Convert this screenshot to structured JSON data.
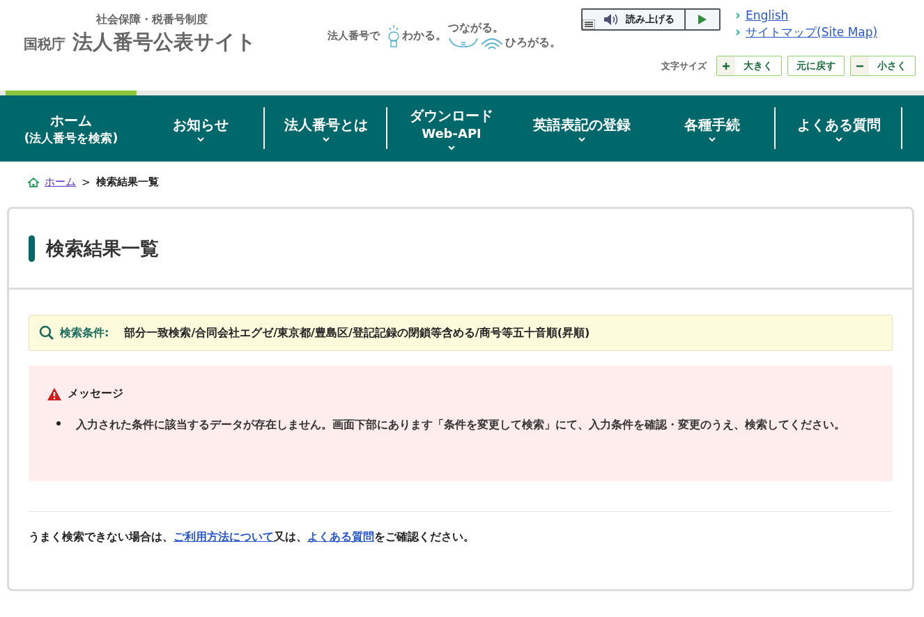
{
  "header": {
    "logo": {
      "subtitle": "社会保障・税番号制度",
      "agency": "国税庁",
      "title": "法人番号公表サイト"
    },
    "slogan": {
      "lead": "法人番号で",
      "words": [
        "わかる。",
        "つながる。",
        "ひろがる。"
      ]
    },
    "read_aloud": {
      "label": "読み上げる"
    },
    "links": [
      "English",
      "サイトマップ(Site Map)"
    ],
    "font_size": {
      "label": "文字サイズ",
      "buttons": [
        {
          "kind": "plus",
          "label": "大きく"
        },
        {
          "kind": "reset",
          "label": "元に戻す"
        },
        {
          "kind": "minus",
          "label": "小さく"
        }
      ]
    }
  },
  "nav": [
    {
      "lines": [
        "ホーム",
        "(法人番号を検索)"
      ],
      "selected": true,
      "has_menu": false,
      "divider": false
    },
    {
      "lines": [
        "お知らせ"
      ],
      "selected": false,
      "has_menu": true,
      "divider": true
    },
    {
      "lines": [
        "法人番号とは"
      ],
      "selected": false,
      "has_menu": true,
      "divider": true
    },
    {
      "lines": [
        "ダウンロード",
        "Web-API"
      ],
      "selected": false,
      "has_menu": true,
      "divider": false
    },
    {
      "lines": [
        "英語表記の登録"
      ],
      "selected": false,
      "has_menu": true,
      "divider": false
    },
    {
      "lines": [
        "各種手続"
      ],
      "selected": false,
      "has_menu": true,
      "divider": true
    },
    {
      "lines": [
        "よくある質問"
      ],
      "selected": false,
      "has_menu": true,
      "divider": true
    }
  ],
  "breadcrumb": {
    "home": "ホーム",
    "separator": ">",
    "current": "検索結果一覧"
  },
  "page_title": "検索結果一覧",
  "conditions": {
    "label": "検索条件:",
    "value": "部分一致検索/合同会社エグゼ/東京都/豊島区/登記記録の閉鎖等含める/商号等五十音順(昇順)"
  },
  "message": {
    "title": "メッセージ",
    "items": [
      "入力された条件に該当するデータが存在しません。画面下部にあります「条件を変更して検索」にて、入力条件を確認・変更のうえ、検索してください。"
    ]
  },
  "help": {
    "parts": [
      {
        "kind": "text",
        "text": "うまく検索できない場合は、"
      },
      {
        "kind": "link",
        "text": "ご利用方法について"
      },
      {
        "kind": "text",
        "text": "又は、"
      },
      {
        "kind": "link",
        "text": "よくある質問"
      },
      {
        "kind": "text",
        "text": "をご確認ください。"
      }
    ]
  }
}
